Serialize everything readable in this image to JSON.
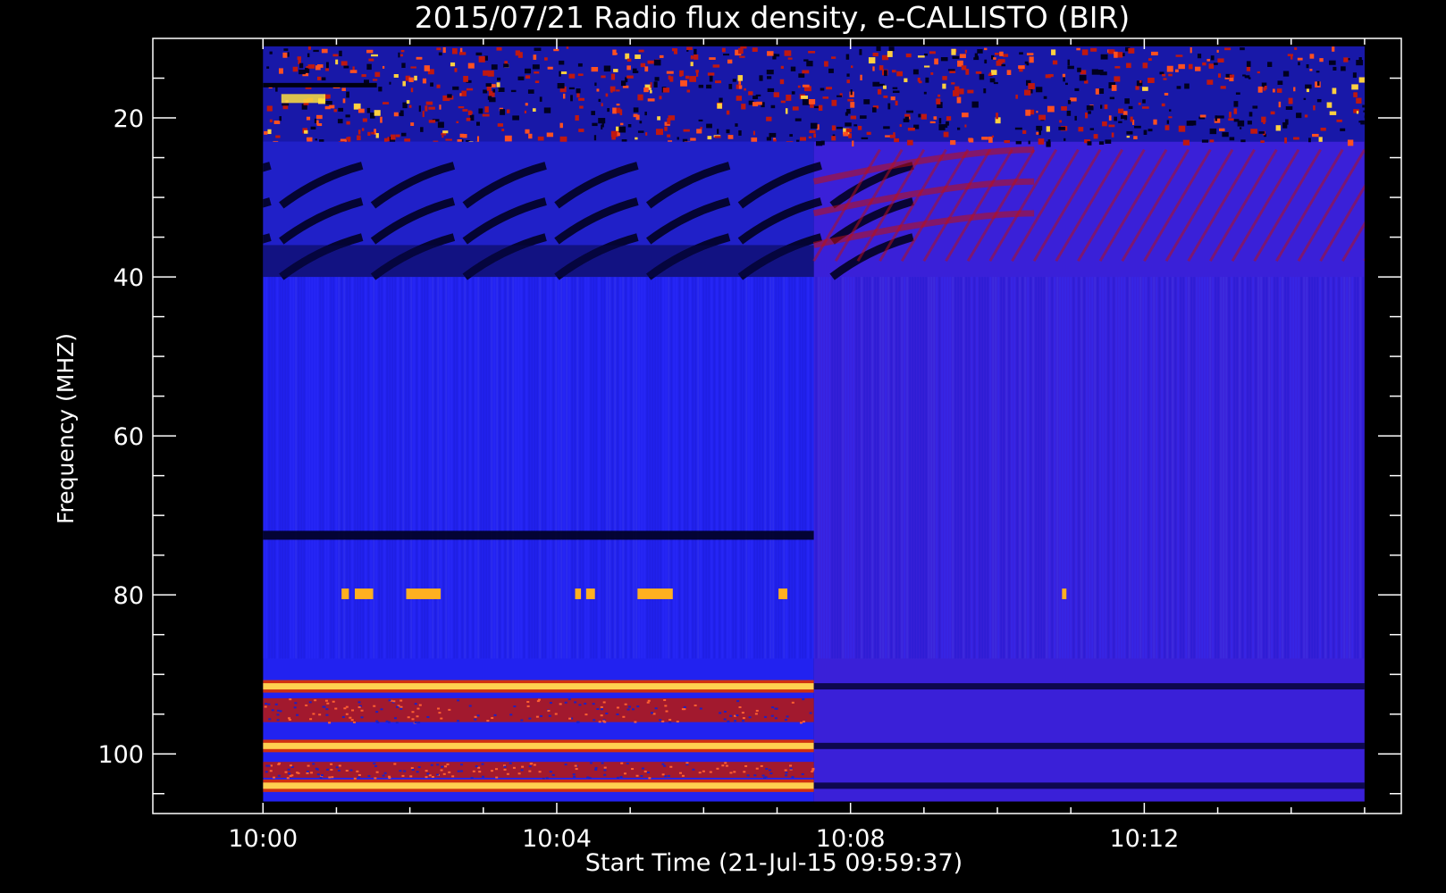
{
  "chart_data": {
    "type": "heatmap",
    "title": "2015/07/21  Radio flux density, e-CALLISTO (BIR)",
    "xlabel": "Start Time (21-Jul-15 09:59:37)",
    "ylabel": "Frequency (MHZ)",
    "x_axis": {
      "unit": "minutes after 10:00",
      "range": [
        -1.5,
        15.5
      ],
      "data_range": [
        0,
        15
      ],
      "major_ticks": [
        {
          "value": 0,
          "label": "10:00"
        },
        {
          "value": 4,
          "label": "10:04"
        },
        {
          "value": 8,
          "label": "10:08"
        },
        {
          "value": 12,
          "label": "10:12"
        }
      ],
      "minor_ticks": [
        1,
        2,
        3,
        5,
        6,
        7,
        9,
        10,
        11,
        13,
        14,
        15
      ]
    },
    "y_axis": {
      "unit": "MHz",
      "inverted": true,
      "range": [
        10,
        107.5
      ],
      "data_range": [
        11,
        106
      ],
      "major_ticks": [
        {
          "value": 20,
          "label": "20"
        },
        {
          "value": 40,
          "label": "40"
        },
        {
          "value": 60,
          "label": "60"
        },
        {
          "value": 80,
          "label": "80"
        },
        {
          "value": 100,
          "label": "100"
        }
      ],
      "minor_ticks": [
        15,
        25,
        30,
        35,
        45,
        50,
        55,
        65,
        70,
        75,
        85,
        90,
        95,
        105
      ]
    },
    "segments": [
      {
        "t_start": 0,
        "t_end": 7.5,
        "background_color": "#2222f0"
      },
      {
        "t_start": 7.5,
        "t_end": 15,
        "background_color": "#3a20d8"
      }
    ],
    "features": [
      {
        "kind": "rfi_band",
        "f_start": 11,
        "f_end": 23,
        "t_start": 0,
        "t_end": 15,
        "intensity": "high"
      },
      {
        "kind": "dark_stripes",
        "f_start": 23,
        "f_end": 40,
        "t_start": 0,
        "t_end": 7.5
      },
      {
        "kind": "red_stripes",
        "f_start": 23,
        "f_end": 38,
        "t_start": 7.5,
        "t_end": 15
      },
      {
        "kind": "dark_line",
        "f": 72.5,
        "t_start": 0,
        "t_end": 7.5
      },
      {
        "kind": "bright_band",
        "f": 91.5,
        "t_start": 0,
        "t_end": 7.5
      },
      {
        "kind": "red_band",
        "f_start": 93,
        "f_end": 96,
        "t_start": 0,
        "t_end": 7.5
      },
      {
        "kind": "bright_band",
        "f": 99,
        "t_start": 0,
        "t_end": 7.5
      },
      {
        "kind": "red_band",
        "f_start": 101,
        "f_end": 103,
        "t_start": 0,
        "t_end": 7.5
      },
      {
        "kind": "bright_band",
        "f": 104,
        "t_start": 0,
        "t_end": 7.5
      },
      {
        "kind": "dark_line",
        "f": 91.5,
        "t_start": 7.5,
        "t_end": 15
      },
      {
        "kind": "dark_line",
        "f": 99,
        "t_start": 7.5,
        "t_end": 15
      },
      {
        "kind": "dark_line",
        "f": 104,
        "t_start": 7.5,
        "t_end": 15
      }
    ],
    "bursts_80mhz": [
      {
        "t_start": 1.07,
        "t_end": 1.17
      },
      {
        "t_start": 1.25,
        "t_end": 1.5
      },
      {
        "t_start": 1.95,
        "t_end": 2.42
      },
      {
        "t_start": 4.25,
        "t_end": 4.33
      },
      {
        "t_start": 4.4,
        "t_end": 4.52
      },
      {
        "t_start": 5.1,
        "t_end": 5.58
      },
      {
        "t_start": 7.02,
        "t_end": 7.14
      },
      {
        "t_start": 10.88,
        "t_end": 10.94
      }
    ],
    "colors": {
      "background": "#000000",
      "text": "#ffffff",
      "hot": "#ffd040",
      "warm": "#cc2010",
      "dark": "#000028"
    }
  }
}
